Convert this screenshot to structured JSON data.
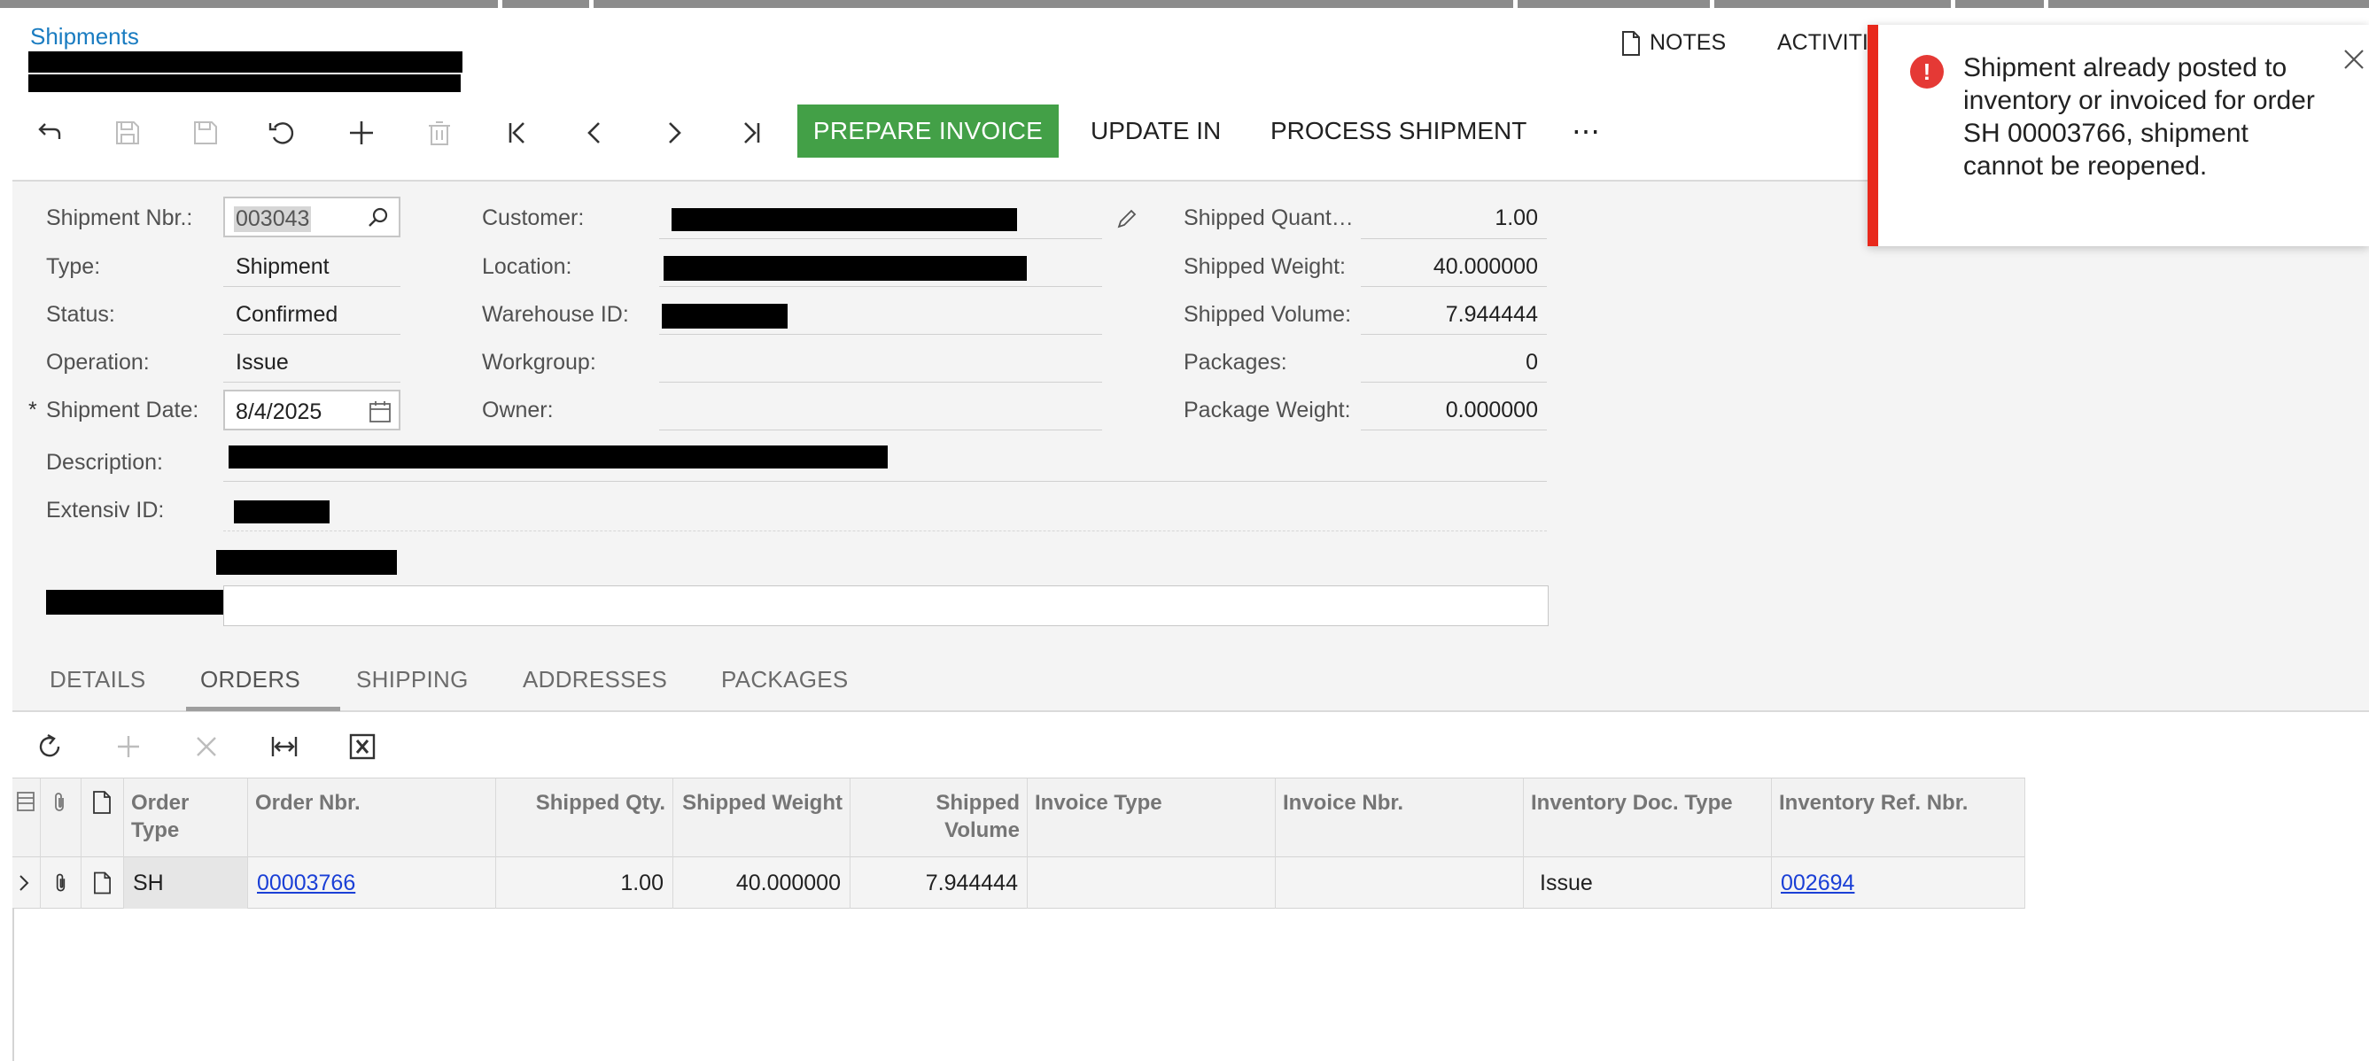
{
  "breadcrumb": "Shipments",
  "header": {
    "notes_label": "NOTES",
    "activities_label": "ACTIVITI"
  },
  "toolbar": {
    "prepare_invoice": "PREPARE INVOICE",
    "update_in": "UPDATE IN",
    "process_shipment": "PROCESS SHIPMENT",
    "more": "⋯"
  },
  "form": {
    "shipment_nbr": {
      "label": "Shipment Nbr.:",
      "value": "003043"
    },
    "type": {
      "label": "Type:",
      "value": "Shipment"
    },
    "status": {
      "label": "Status:",
      "value": "Confirmed"
    },
    "operation": {
      "label": "Operation:",
      "value": "Issue"
    },
    "shipment_date": {
      "required_mark": "*",
      "label": "Shipment Date:",
      "value": "8/4/2025"
    },
    "description": {
      "label": "Description:"
    },
    "extensiv_id": {
      "label": "Extensiv ID:"
    },
    "customer": {
      "label": "Customer:"
    },
    "location": {
      "label": "Location:"
    },
    "warehouse_id": {
      "label": "Warehouse ID:"
    },
    "workgroup": {
      "label": "Workgroup:"
    },
    "owner": {
      "label": "Owner:"
    },
    "shipped_quantity": {
      "label": "Shipped Quant…",
      "value": "1.00"
    },
    "shipped_weight": {
      "label": "Shipped Weight:",
      "value": "40.000000"
    },
    "shipped_volume": {
      "label": "Shipped Volume:",
      "value": "7.944444"
    },
    "packages": {
      "label": "Packages:",
      "value": "0"
    },
    "package_weight": {
      "label": "Package Weight:",
      "value": "0.000000"
    }
  },
  "tabs": [
    "DETAILS",
    "ORDERS",
    "SHIPPING",
    "ADDRESSES",
    "PACKAGES"
  ],
  "active_tab": "ORDERS",
  "grid": {
    "headers": {
      "order_type": "Order Type",
      "order_nbr": "Order Nbr.",
      "shipped_qty": "Shipped Qty.",
      "shipped_weight": "Shipped Weight",
      "shipped_volume": "Shipped Volume",
      "invoice_type": "Invoice Type",
      "invoice_nbr": "Invoice Nbr.",
      "inventory_doc_type": "Inventory Doc. Type",
      "inventory_ref_nbr": "Inventory Ref. Nbr."
    },
    "rows": [
      {
        "order_type": "SH",
        "order_nbr": "00003766",
        "shipped_qty": "1.00",
        "shipped_weight": "40.000000",
        "shipped_volume": "7.944444",
        "invoice_type": "",
        "invoice_nbr": "",
        "inventory_doc_type": "Issue",
        "inventory_ref_nbr": "002694"
      }
    ]
  },
  "toast": {
    "message": "Shipment already posted to inventory or invoiced for order SH 00003766, shipment cannot be reopened."
  },
  "colors": {
    "accent_green": "#43a047",
    "link_blue": "#1a3fd6",
    "error_red": "#e8281b"
  }
}
